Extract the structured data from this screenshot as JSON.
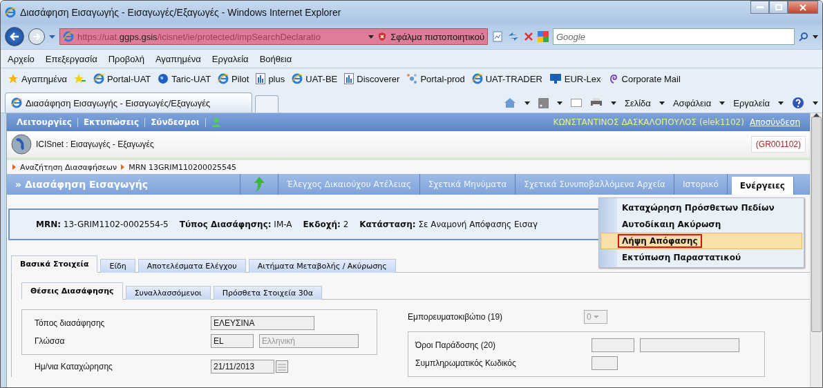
{
  "window": {
    "title": "Διασάφηση Εισαγωγής - Εισαγωγές/Εξαγωγές - Windows Internet Explorer"
  },
  "address_bar": {
    "url_host": "https://uat.",
    "url_domain": "ggps.gsis",
    "url_path": "/icisnet/ie/protected/impSearchDeclaratio",
    "cert_error": "Σφάλμα πιστοποιητικού"
  },
  "search": {
    "placeholder": "Google"
  },
  "menu": [
    "Αρχείο",
    "Επεξεργασία",
    "Προβολή",
    "Αγαπημένα",
    "Εργαλεία",
    "Βοήθεια"
  ],
  "favorites": {
    "label": "Αγαπημένα",
    "links": [
      {
        "label": "Portal-UAT",
        "kind": "ie"
      },
      {
        "label": "Taric-UAT",
        "kind": "globe"
      },
      {
        "label": "Pilot",
        "kind": "ie"
      },
      {
        "label": "plus",
        "kind": "chart"
      },
      {
        "label": "UAT-BE",
        "kind": "ie"
      },
      {
        "label": "Discoverer",
        "kind": "chart"
      },
      {
        "label": "Portal-prod",
        "kind": "network"
      },
      {
        "label": "UAT-TRADER",
        "kind": "ie"
      },
      {
        "label": "EUR-Lex",
        "kind": "monitor"
      },
      {
        "label": "Corporate Mail",
        "kind": "swirl"
      }
    ]
  },
  "browser_tab": {
    "title": "Διασάφηση Εισαγωγής - Εισαγωγές/Εξαγωγές"
  },
  "command_bar": [
    "Σελίδα",
    "Ασφάλεια",
    "Εργαλεία"
  ],
  "portal": {
    "menu": [
      "Λειτουργίες",
      "Εκτυπώσεις",
      "Σύνδεσμοι"
    ],
    "user": "ΚΩΝΣΤΑΝΤΙΝΟΣ ΔΑΣΚΑΛΟΠΟΥΛΟΣ (elek1102)",
    "logout": "Αποσύνδεση"
  },
  "app": {
    "title": "ICISnet : Εισαγωγές - Εξαγωγές",
    "office": "(GR001102)"
  },
  "breadcrumb": [
    "Αναζήτηση Διασαφήσεων",
    "MRN 13GRIM110200025545"
  ],
  "section_title": "» Διασάφηση Εισαγωγής",
  "nav_tabs": [
    {
      "label": "Έλεγχος Δικαιούχου Ατέλειας",
      "selected": false
    },
    {
      "label": "Σχετικά Μηνύματα",
      "selected": false
    },
    {
      "label": "Σχετικά Συνυποβαλλόμενα Αρχεία",
      "selected": false
    },
    {
      "label": "Ιστορικό",
      "selected": false
    },
    {
      "label": "Ενέργειες",
      "selected": true
    }
  ],
  "actions_menu": [
    {
      "label": "Καταχώρηση Πρόσθετων Πεδίων",
      "highlighted": false
    },
    {
      "label": "Αυτοδίκαιη Ακύρωση",
      "highlighted": false
    },
    {
      "label": "Λήψη Απόφασης",
      "highlighted": true
    },
    {
      "label": "Εκτύπωση Παραστατικού",
      "highlighted": false
    }
  ],
  "info": [
    {
      "label": "MRN:",
      "value": "13-GRIM1102-0002554-5"
    },
    {
      "label": "Τύπος Διασάφησης:",
      "value": "IM-A"
    },
    {
      "label": "Εκδοχή:",
      "value": "2"
    },
    {
      "label": "Κατάσταση:",
      "value": "Σε Αναμονή Απόφασης Εισαγ"
    }
  ],
  "tabs": [
    {
      "label": "Βασικά Στοιχεία",
      "selected": true
    },
    {
      "label": "Είδη",
      "selected": false
    },
    {
      "label": "Αποτελέσματα Ελέγχου",
      "selected": false
    },
    {
      "label": "Αιτήματα Μεταβολής / Ακύρωσης",
      "selected": false
    }
  ],
  "subtabs": [
    {
      "label": "Θέσεις Διασάφησης",
      "selected": true
    },
    {
      "label": "Συναλλασσόμενοι",
      "selected": false
    },
    {
      "label": "Πρόσθετα Στοιχεία 30α",
      "selected": false
    }
  ],
  "left_group": [
    {
      "label": "Τόπος διασάφησης",
      "values": [
        "ΕΛΕΥΣΙΝΑ"
      ]
    },
    {
      "label": "Γλώσσα",
      "values": [
        "EL",
        "Ελληνική"
      ]
    }
  ],
  "date_field": {
    "label": "Ημ/νια Καταχώρησης",
    "value": "21/11/2013"
  },
  "container_field": {
    "label": "Εμπορευματοκιβώτιο (19)",
    "value": "0",
    "disabled": true
  },
  "right_group": [
    {
      "label": "Όροι Παράδοσης (20)",
      "fields": [
        {
          "kind": "short"
        },
        {
          "kind": "long"
        }
      ]
    },
    {
      "label": "Συμπληρωματικός Κωδικός",
      "fields": [
        {
          "kind": "short"
        }
      ]
    }
  ]
}
